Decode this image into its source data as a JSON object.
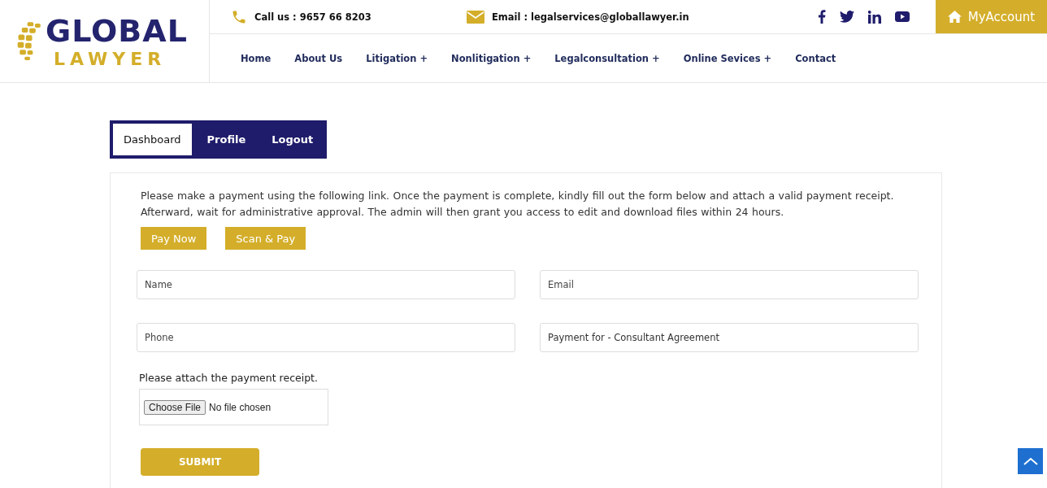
{
  "logo": {
    "line_1": "GLOBAL",
    "line_2": "LAWYER"
  },
  "contact": {
    "phone": "Call us : 9657 66 8203",
    "email": "Email : legalservices@globallawyer.in"
  },
  "account_button": "MyAccount",
  "nav": [
    {
      "label": "Home"
    },
    {
      "label": "About Us"
    },
    {
      "label": "Litigation +"
    },
    {
      "label": "Nonlitigation +"
    },
    {
      "label": "Legalconsultation +"
    },
    {
      "label": "Online Sevices +"
    },
    {
      "label": "Contact"
    }
  ],
  "tabs": [
    {
      "label": "Dashboard",
      "selected": true
    },
    {
      "label": "Profile",
      "selected": false
    },
    {
      "label": "Logout",
      "selected": false
    }
  ],
  "instructions": "Please make a payment using the following link. Once the payment is complete, kindly fill out the form below and attach a valid payment receipt. Afterward, wait for administrative approval. The admin will then grant you access to edit and download files within 24 hours.",
  "pay_buttons": [
    "Pay Now",
    "Scan & Pay"
  ],
  "fields": [
    {
      "placeholder": "Name"
    },
    {
      "placeholder": "Email"
    },
    {
      "placeholder": "Phone"
    },
    {
      "value": "Payment for - Consultant Agreement"
    }
  ],
  "attach_label": "Please attach the payment receipt.",
  "file_input": {
    "button": "Choose File",
    "status": "No file chosen"
  },
  "submit": "SUBMIT"
}
